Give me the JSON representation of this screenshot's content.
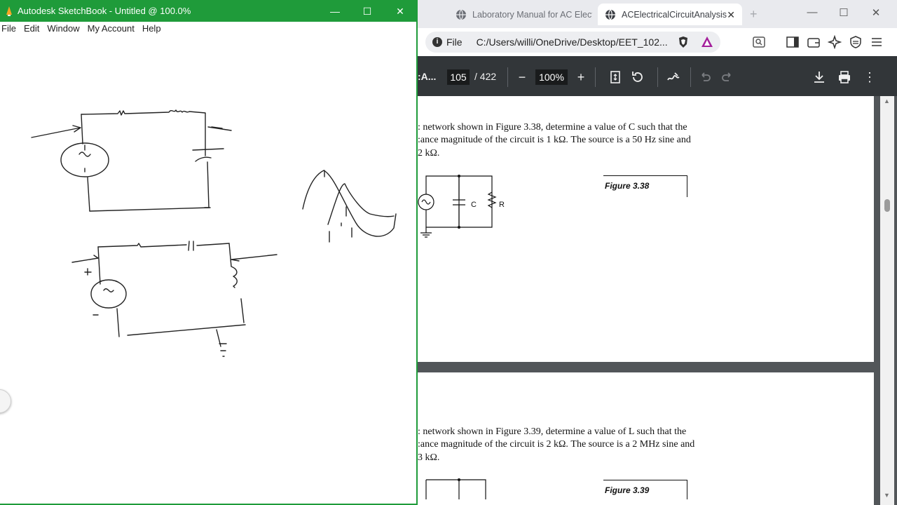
{
  "sketchbook": {
    "title": "Autodesk SketchBook - Untitled @ 100.0%",
    "menu": [
      "File",
      "Edit",
      "Window",
      "My Account",
      "Help"
    ],
    "controls": {
      "minimize": "—",
      "maximize": "☐",
      "close": "✕"
    }
  },
  "browser": {
    "tabs": [
      {
        "label": "Laboratory Manual for AC Elect",
        "active": false
      },
      {
        "label": "ACElectricalCircuitAnalysis",
        "active": true
      }
    ],
    "new_tab": "+",
    "address": {
      "scheme_label": "File",
      "path": "C:/Users/willi/OneDrive/Desktop/EET_102..."
    },
    "pdf": {
      "title": ":A...",
      "page": "105",
      "total": "/ 422",
      "zoom": "100%"
    }
  },
  "document": {
    "page1": {
      "lines": [
        ": network shown in Figure 3.38, determine a value of C such that the",
        ":ance magnitude of the circuit is 1 kΩ. The source is a 50 Hz sine and",
        "2 kΩ."
      ],
      "figure_label": "Figure 3.38",
      "circuit_labels": {
        "capacitor": "C",
        "resistor": "R"
      }
    },
    "page2": {
      "lines": [
        ": network shown in Figure 3.39, determine a value of L such that the",
        ":ance magnitude of the circuit is 2 kΩ. The source is a 2 MHz sine and",
        "3 kΩ."
      ],
      "figure_label": "Figure 3.39"
    }
  },
  "colors": {
    "sketch_accent": "#1f9b3a",
    "pdf_toolbar": "#323639",
    "pdf_bg": "#525659"
  }
}
